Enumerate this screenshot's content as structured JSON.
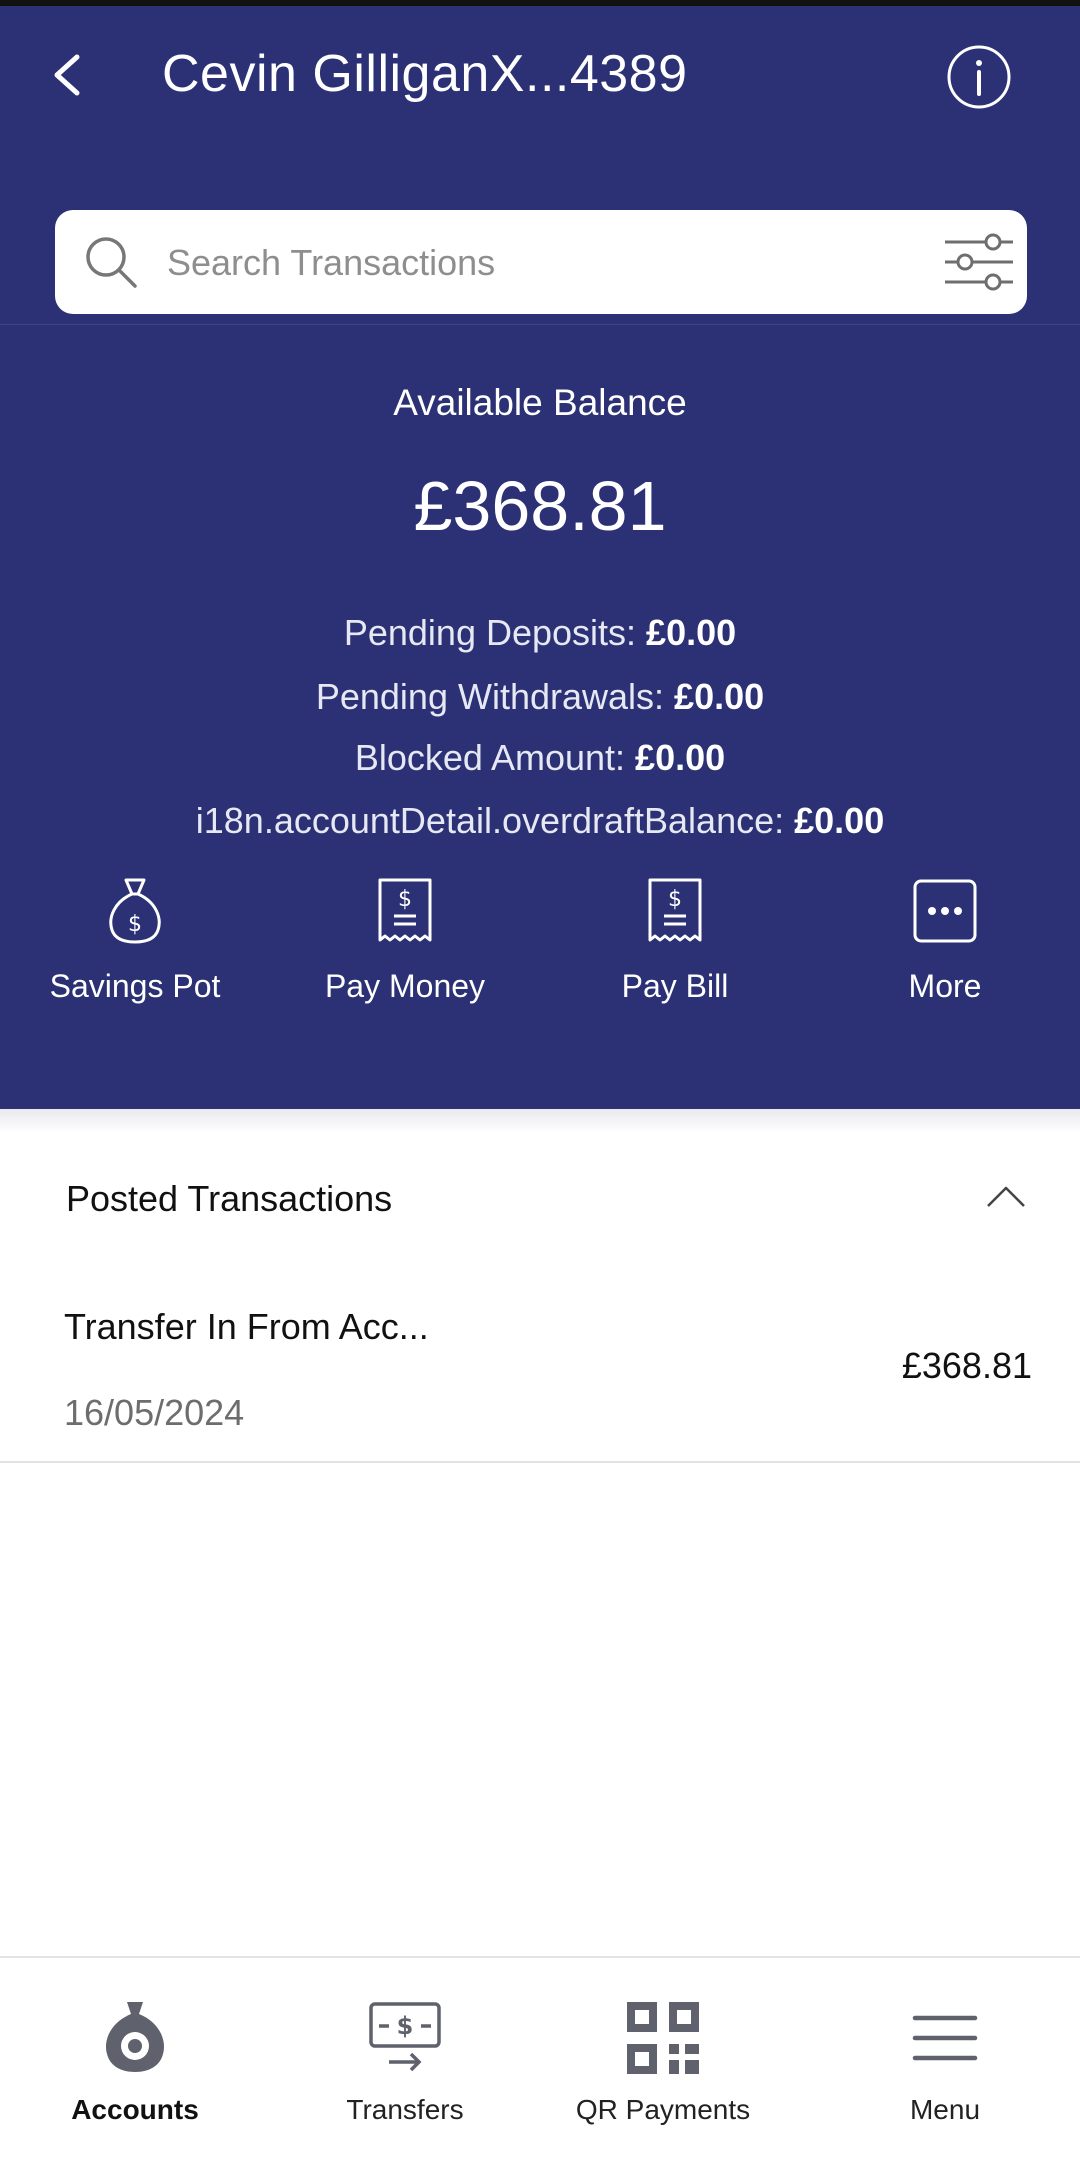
{
  "header": {
    "title": "Cevin GilliganX...4389",
    "back_icon": "chevron-left-icon",
    "info_icon": "info-circle-icon"
  },
  "search": {
    "placeholder": "Search Transactions",
    "value": ""
  },
  "balance": {
    "label": "Available Balance",
    "amount": "£368.81",
    "pending": [
      {
        "label": "Pending Deposits:",
        "value": "£0.00"
      },
      {
        "label": "Pending Withdrawals:",
        "value": "£0.00"
      },
      {
        "label": "Blocked Amount:",
        "value": "£0.00"
      },
      {
        "label": "i18n.accountDetail.overdraftBalance:",
        "value": "£0.00"
      }
    ]
  },
  "actions": [
    {
      "label": "Savings Pot",
      "icon": "money-bag-icon"
    },
    {
      "label": "Pay Money",
      "icon": "receipt-icon"
    },
    {
      "label": "Pay Bill",
      "icon": "receipt-icon"
    },
    {
      "label": "More",
      "icon": "more-dots-icon"
    }
  ],
  "posted": {
    "title": "Posted Transactions",
    "transactions": [
      {
        "description": "Transfer In From Acc...",
        "date": "16/05/2024",
        "amount": "£368.81"
      }
    ]
  },
  "tabs": [
    {
      "label": "Accounts",
      "icon": "money-bag-icon",
      "active": true
    },
    {
      "label": "Transfers",
      "icon": "transfer-icon",
      "active": false
    },
    {
      "label": "QR Payments",
      "icon": "qr-code-icon",
      "active": false
    },
    {
      "label": "Menu",
      "icon": "hamburger-menu-icon",
      "active": false
    }
  ],
  "colors": {
    "header_bg": "#2b3174",
    "icon_gray": "#5f616c"
  }
}
